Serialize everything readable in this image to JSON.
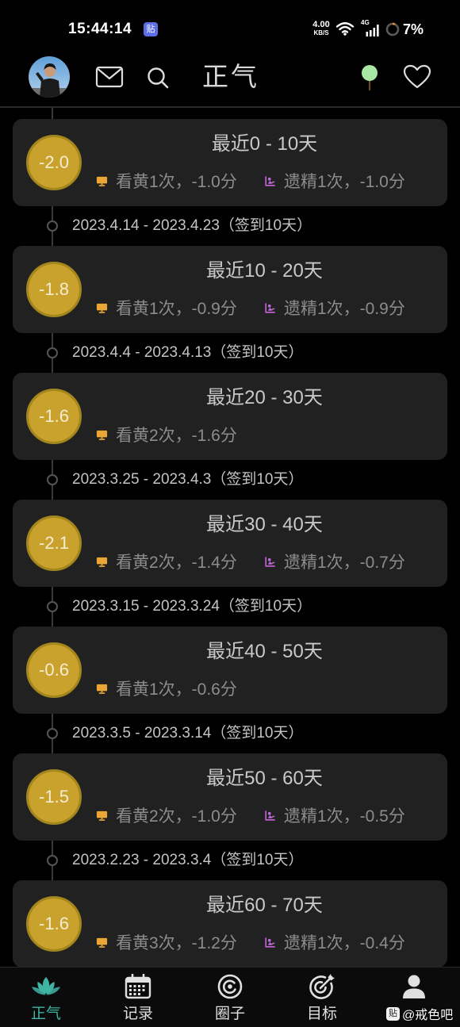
{
  "status_bar": {
    "time": "15:44:14",
    "app_badge": "贴",
    "net_speed": "4.00",
    "net_speed_unit": "KB/S",
    "network_type": "4G",
    "battery": "7%",
    "battery_level": 0.07,
    "icons": [
      "wifi-icon",
      "signal-icon",
      "battery-ring-icon"
    ]
  },
  "header": {
    "title": "正气",
    "icons": [
      "avatar",
      "mail-icon",
      "search-icon",
      "tree-icon",
      "heart-icon"
    ]
  },
  "periods": [
    {
      "score": "-2.0",
      "title": "最近0 - 10天",
      "details": [
        {
          "icon": "monitor-icon",
          "text": "看黄1次，-1.0分"
        },
        {
          "icon": "bath-icon",
          "text": "遗精1次，-1.0分"
        }
      ]
    },
    {
      "score": "-1.8",
      "title": "最近10 - 20天",
      "details": [
        {
          "icon": "monitor-icon",
          "text": "看黄1次，-0.9分"
        },
        {
          "icon": "bath-icon",
          "text": "遗精1次，-0.9分"
        }
      ]
    },
    {
      "score": "-1.6",
      "title": "最近20 - 30天",
      "details": [
        {
          "icon": "monitor-icon",
          "text": "看黄2次，-1.6分"
        }
      ]
    },
    {
      "score": "-2.1",
      "title": "最近30 - 40天",
      "details": [
        {
          "icon": "monitor-icon",
          "text": "看黄2次，-1.4分"
        },
        {
          "icon": "bath-icon",
          "text": "遗精1次，-0.7分"
        }
      ]
    },
    {
      "score": "-0.6",
      "title": "最近40 - 50天",
      "details": [
        {
          "icon": "monitor-icon",
          "text": "看黄1次，-0.6分"
        }
      ]
    },
    {
      "score": "-1.5",
      "title": "最近50 - 60天",
      "details": [
        {
          "icon": "monitor-icon",
          "text": "看黄2次，-1.0分"
        },
        {
          "icon": "bath-icon",
          "text": "遗精1次，-0.5分"
        }
      ]
    },
    {
      "score": "-1.6",
      "title": "最近60 - 70天",
      "details": [
        {
          "icon": "monitor-icon",
          "text": "看黄3次，-1.2分"
        },
        {
          "icon": "bath-icon",
          "text": "遗精1次，-0.4分"
        }
      ]
    }
  ],
  "date_ranges": [
    "2023.4.14 - 2023.4.23（签到10天）",
    "2023.4.4 - 2023.4.13（签到10天）",
    "2023.3.25 - 2023.4.3（签到10天）",
    "2023.3.15 - 2023.3.24（签到10天）",
    "2023.3.5 - 2023.3.14（签到10天）",
    "2023.2.23 - 2023.3.4（签到10天）"
  ],
  "nav": [
    {
      "label": "正气",
      "icon": "lotus-icon",
      "active": true
    },
    {
      "label": "记录",
      "icon": "calendar-icon",
      "active": false
    },
    {
      "label": "圈子",
      "icon": "circle-icon",
      "active": false
    },
    {
      "label": "目标",
      "icon": "target-icon",
      "active": false
    },
    {
      "icon": "profile-icon",
      "active": false
    }
  ],
  "watermark": {
    "badge": "贴",
    "text": "@戒色吧"
  },
  "colors": {
    "background": "#000000",
    "card": "#212121",
    "score_badge": "#c8a22c",
    "accent": "#3fb4a3",
    "monitor_icon": "#eba636",
    "bath_icon": "#c567d8",
    "tree_icon": "#a8e6a3"
  }
}
